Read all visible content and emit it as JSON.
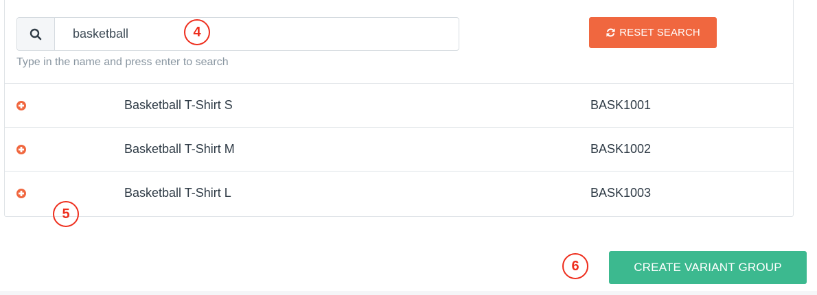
{
  "search": {
    "value": "basketball",
    "help_text": "Type in the name and press enter to search",
    "icon": "search-icon"
  },
  "reset_button": {
    "label": "RESET SEARCH",
    "icon": "refresh-icon",
    "color": "#f0673f"
  },
  "products": [
    {
      "name": "Basketball T-Shirt S",
      "sku": "BASK1001",
      "icon": "add-circle-icon"
    },
    {
      "name": "Basketball T-Shirt M",
      "sku": "BASK1002",
      "icon": "add-circle-icon"
    },
    {
      "name": "Basketball T-Shirt L",
      "sku": "BASK1003",
      "icon": "add-circle-icon"
    }
  ],
  "create_button": {
    "label": "CREATE VARIANT GROUP",
    "color": "#3cb98f"
  },
  "callouts": [
    "4",
    "5",
    "6"
  ],
  "colors": {
    "accent_orange": "#f0673f",
    "accent_green": "#3cb98f",
    "callout_red": "#ee2d1c"
  }
}
